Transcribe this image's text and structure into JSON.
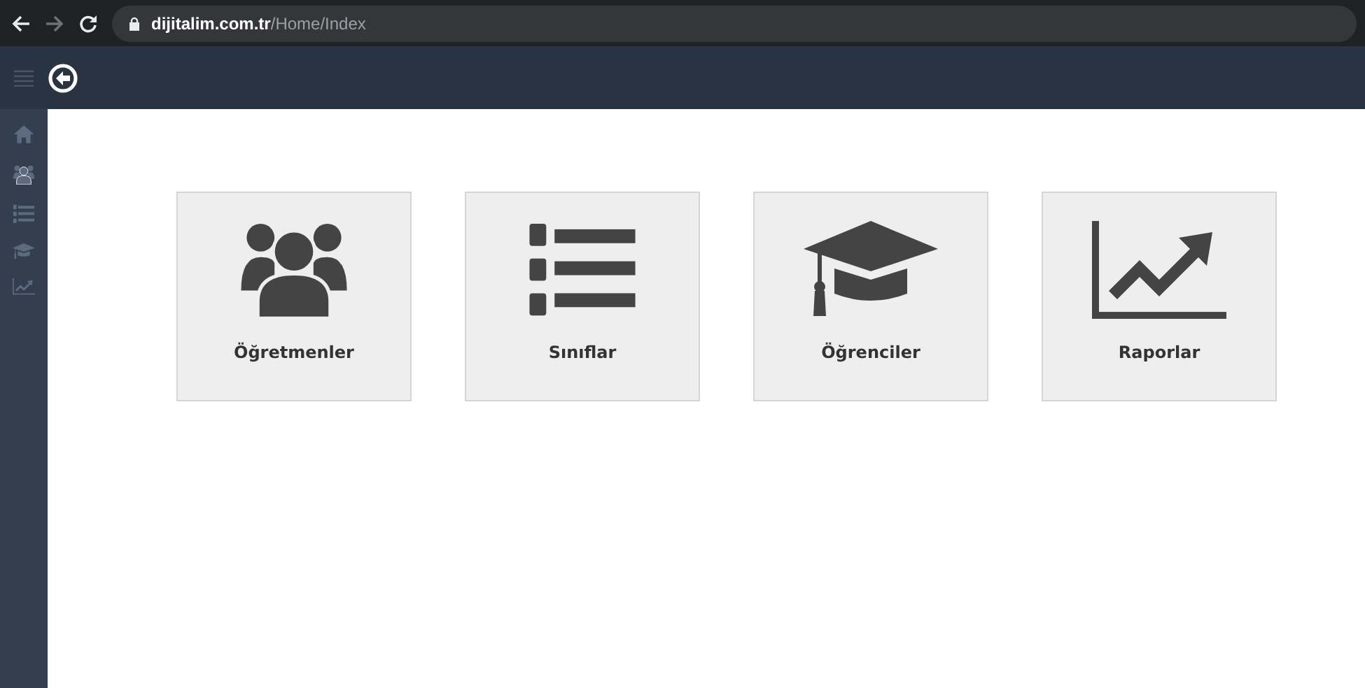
{
  "browser": {
    "url_host": "dijitalim.com.tr",
    "url_path": "/Home/Index"
  },
  "tiles": [
    {
      "label": "Öğretmenler"
    },
    {
      "label": "Sınıflar"
    },
    {
      "label": "Öğrenciler"
    },
    {
      "label": "Raporlar"
    }
  ]
}
